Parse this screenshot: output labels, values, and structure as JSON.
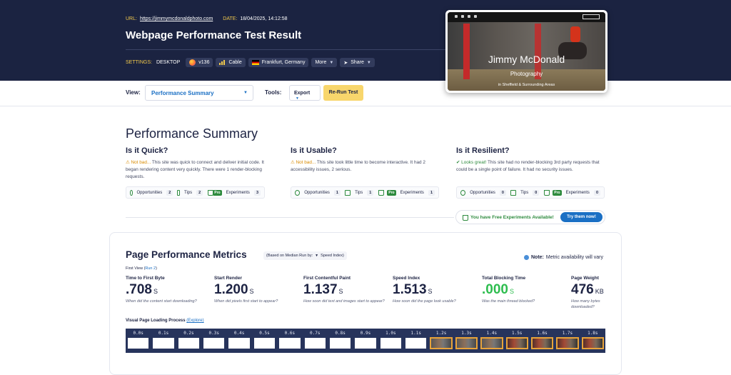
{
  "header": {
    "url_key": "URL:",
    "url": "https://jimmymcdonaldphoto.com",
    "date_key": "DATE:",
    "date": "18/04/2025, 14:12:58",
    "title": "Webpage Performance Test Result",
    "settings_key": "SETTINGS:",
    "device": "DESKTOP",
    "browser": "v136",
    "connection": "Cable",
    "location": "Frankfurt, Germany",
    "more": "More",
    "share": "Share"
  },
  "preview": {
    "name": "Jimmy McDonald",
    "subtitle": "Photography",
    "location": "in Sheffield & Surrounding Areas"
  },
  "toolbar": {
    "view_label": "View:",
    "view_value": "Performance Summary",
    "tools_label": "Tools:",
    "export": "Export",
    "rerun": "Re-Run Test"
  },
  "summary": {
    "title": "Performance Summary",
    "columns": [
      {
        "heading": "Is it Quick?",
        "verdict": "Not bad...",
        "text": "This site was quick to connect and deliver initial code. It began rendering content very quickly. There were 1 render-blocking requests.",
        "opportunities_label": "Opportunities",
        "opportunities": "2",
        "tips_label": "Tips",
        "tips": "2",
        "pro": "Pro",
        "experiments_label": "Experiments",
        "experiments": "3"
      },
      {
        "heading": "Is it Usable?",
        "verdict": "Not bad...",
        "text": "This site took little time to become interactive. It had 2 accessibility issues, 2 serious.",
        "opportunities_label": "Opportunities",
        "opportunities": "1",
        "tips_label": "Tips",
        "tips": "1",
        "pro": "Pro",
        "experiments_label": "Experiments",
        "experiments": "1"
      },
      {
        "heading": "Is it Resilient?",
        "verdict": "Looks great!",
        "text": "This site had no render-blocking 3rd party requests that could be a single point of failure. It had no security issues.",
        "opportunities_label": "Opportunities",
        "opportunities": "0",
        "tips_label": "Tips",
        "tips": "0",
        "pro": "Pro",
        "experiments_label": "Experiments",
        "experiments": "0"
      }
    ],
    "free_experiments": "You have Free Experiments Available!",
    "try_button": "Try them now!"
  },
  "metrics": {
    "title": "Page Performance Metrics",
    "based_on": "(Based on Median Run by:",
    "based_value": "Speed Index)",
    "note_label": "Note:",
    "note_text": "Metric availability will vary",
    "first_view": "First View (",
    "run_link": "Run 2",
    "first_view_end": ")",
    "items": [
      {
        "label": "Time to First Byte",
        "value": ".708",
        "unit": "S",
        "question": "When did the content start downloading?"
      },
      {
        "label": "Start Render",
        "value": "1.200",
        "unit": "S",
        "question": "When did pixels first start to appear?"
      },
      {
        "label": "First Contentful Paint",
        "value": "1.137",
        "unit": "S",
        "question": "How soon did text and images start to appear?"
      },
      {
        "label": "Speed Index",
        "value": "1.513",
        "unit": "S",
        "question": "How soon did the page look usable?"
      },
      {
        "label": "Total Blocking Time",
        "value": ".000",
        "unit": "S",
        "question": "Was the main thread blocked?"
      },
      {
        "label": "Page Weight",
        "value": "476",
        "unit": "KB",
        "question": "How many bytes downloaded?"
      }
    ],
    "filmstrip_label": "Visual Page Loading Process",
    "explore": "(Explore)",
    "frames": [
      "0.0s",
      "0.1s",
      "0.2s",
      "0.3s",
      "0.4s",
      "0.5s",
      "0.6s",
      "0.7s",
      "0.8s",
      "0.9s",
      "1.0s",
      "1.1s",
      "1.2s",
      "1.3s",
      "1.4s",
      "1.5s",
      "1.6s",
      "1.7s",
      "1.8s"
    ]
  },
  "colors": {
    "header_bg": "#1b2341",
    "accent_yellow": "#f8d66c",
    "link_blue": "#1a6fc4",
    "good_green": "#2e8b3e",
    "warn_orange": "#d88a00"
  }
}
